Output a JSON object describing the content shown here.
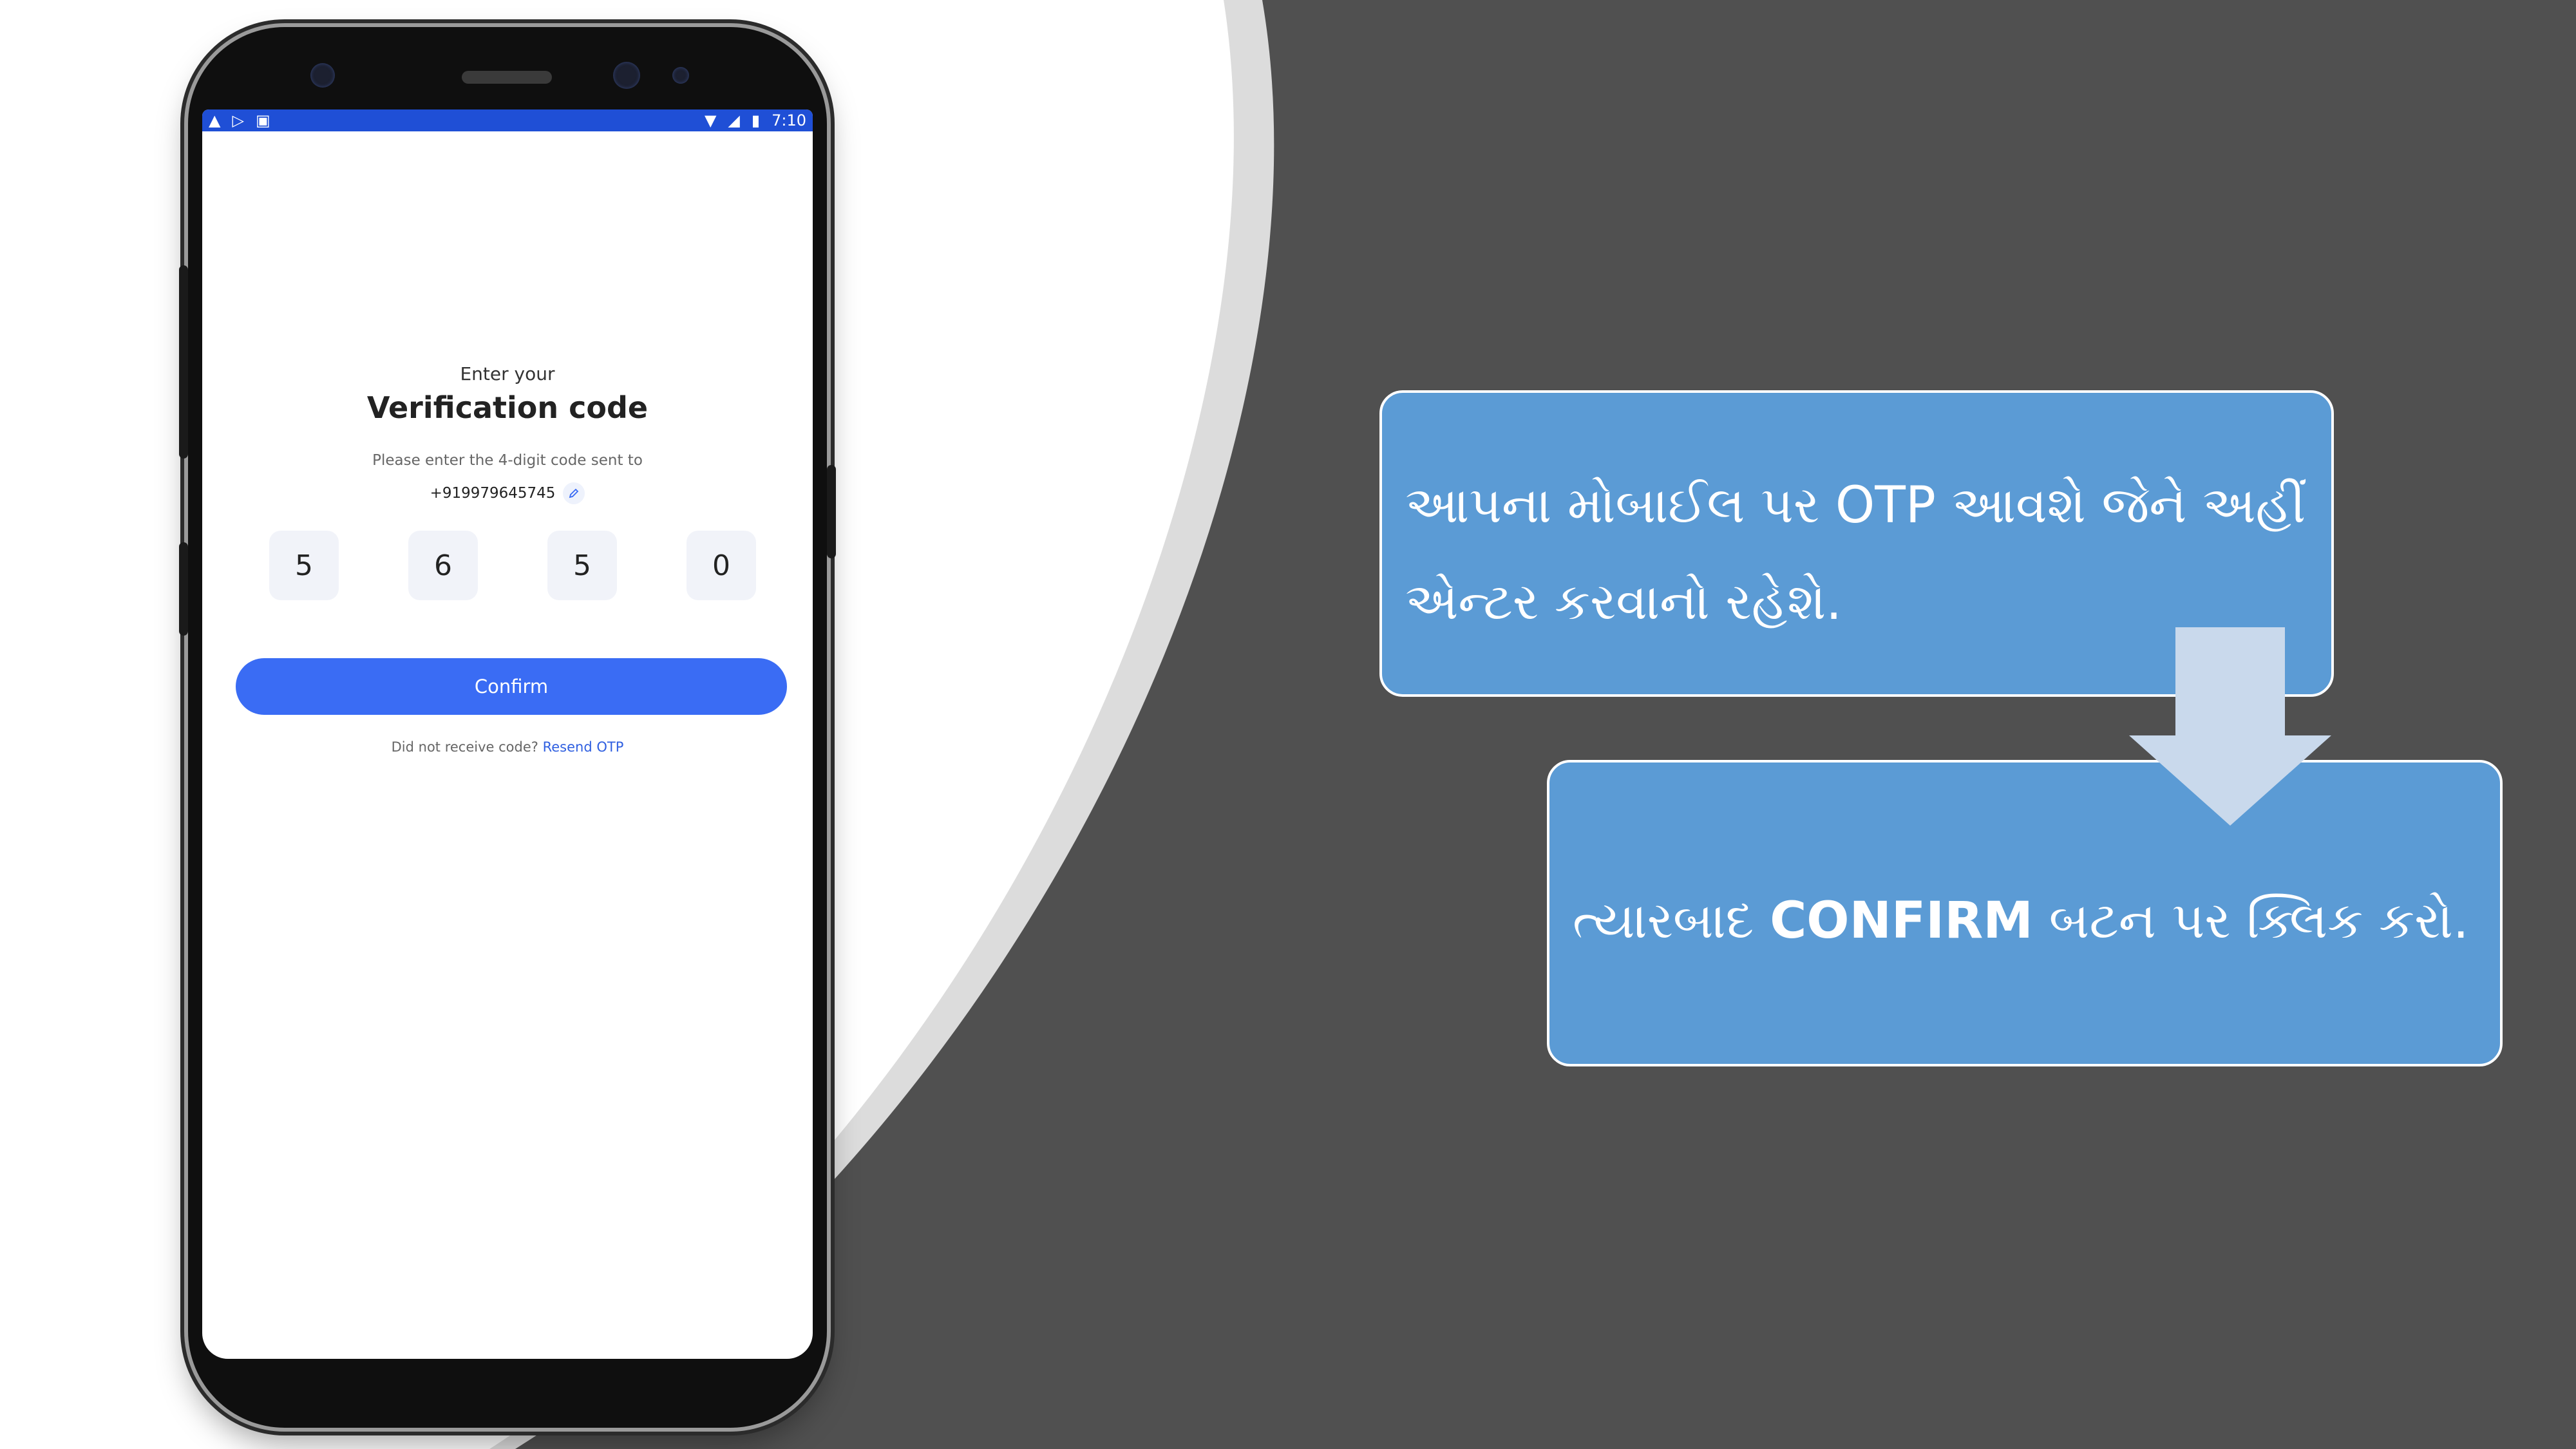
{
  "status_bar": {
    "time": "7:10",
    "left_icons": [
      "warning-icon",
      "play-store-icon",
      "notification-icon"
    ],
    "right_icons": [
      "wifi-icon",
      "signal-icon",
      "battery-icon"
    ]
  },
  "verification": {
    "eyebrow": "Enter your",
    "title": "Verification code",
    "subtitle": "Please enter the 4-digit code sent to",
    "phone_number": "+919979645745",
    "otp_digits": [
      "5",
      "6",
      "5",
      "0"
    ],
    "confirm_label": "Confirm",
    "resend_prompt": "Did not receive code?",
    "resend_link": "Resend OTP"
  },
  "callouts": {
    "first": "આપના મોબાઈલ પર OTP આવશે જેને અહીં એન્ટર કરવાનો રહેશે.",
    "second_pre": "ત્યારબાદ ",
    "second_emphasis": "CONFIRM",
    "second_post": " બટન પર ક્લિક કરો."
  },
  "colors": {
    "background_dark": "#505050",
    "callout_fill": "#5b9bd5",
    "primary_button": "#3a6cf4",
    "status_bar": "#1f4fd6"
  }
}
